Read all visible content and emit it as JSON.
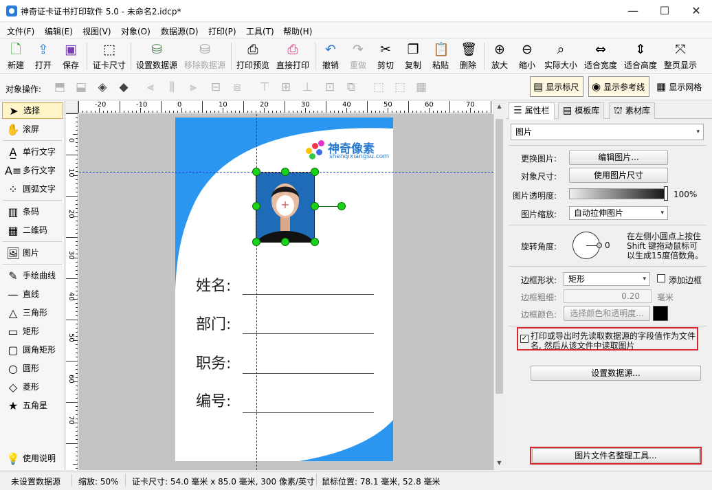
{
  "window": {
    "title": "神奇证卡证书打印软件 5.0 - 未命名2.idcp*"
  },
  "menu": [
    "文件(F)",
    "编辑(E)",
    "视图(V)",
    "对象(O)",
    "数据源(D)",
    "打印(P)",
    "工具(T)",
    "帮助(H)"
  ],
  "toolbar": [
    {
      "label": "新建",
      "icon": "new-file-icon"
    },
    {
      "label": "打开",
      "icon": "open-folder-icon"
    },
    {
      "label": "保存",
      "icon": "save-icon"
    },
    {
      "label": "证卡尺寸",
      "icon": "card-size-icon"
    },
    {
      "label": "设置数据源",
      "icon": "database-icon"
    },
    {
      "label": "移除数据源",
      "icon": "remove-database-icon",
      "disabled": true
    },
    {
      "label": "打印预览",
      "icon": "print-preview-icon"
    },
    {
      "label": "直接打印",
      "icon": "printer-icon"
    },
    {
      "label": "撤销",
      "icon": "undo-icon"
    },
    {
      "label": "重做",
      "icon": "redo-icon",
      "disabled": true
    },
    {
      "label": "剪切",
      "icon": "scissors-icon"
    },
    {
      "label": "复制",
      "icon": "copy-icon"
    },
    {
      "label": "粘贴",
      "icon": "paste-icon"
    },
    {
      "label": "删除",
      "icon": "trash-icon"
    },
    {
      "label": "放大",
      "icon": "zoom-in-icon"
    },
    {
      "label": "缩小",
      "icon": "zoom-out-icon"
    },
    {
      "label": "实际大小",
      "icon": "actual-size-icon"
    },
    {
      "label": "适合宽度",
      "icon": "fit-width-icon"
    },
    {
      "label": "适合高度",
      "icon": "fit-height-icon"
    },
    {
      "label": "整页显示",
      "icon": "fit-page-icon"
    }
  ],
  "toolbar2": {
    "label": "对象操作:",
    "show_ruler": "显示标尺",
    "show_guides": "显示参考线",
    "show_grid": "显示网格"
  },
  "tools": [
    {
      "label": "选择",
      "icon": "arrow-cursor-icon"
    },
    {
      "label": "滚屏",
      "icon": "hand-icon"
    },
    {
      "label": "单行文字",
      "icon": "single-line-text-icon"
    },
    {
      "label": "多行文字",
      "icon": "multi-line-text-icon"
    },
    {
      "label": "圆弧文字",
      "icon": "arc-text-icon"
    },
    {
      "label": "条码",
      "icon": "barcode-icon"
    },
    {
      "label": "二维码",
      "icon": "qrcode-icon"
    },
    {
      "label": "图片",
      "icon": "image-icon"
    },
    {
      "label": "手绘曲线",
      "icon": "pen-icon"
    },
    {
      "label": "直线",
      "icon": "line-icon"
    },
    {
      "label": "三角形",
      "icon": "triangle-icon"
    },
    {
      "label": "矩形",
      "icon": "rectangle-icon"
    },
    {
      "label": "圆角矩形",
      "icon": "rounded-rect-icon"
    },
    {
      "label": "圆形",
      "icon": "circle-icon"
    },
    {
      "label": "菱形",
      "icon": "diamond-icon"
    },
    {
      "label": "五角星",
      "icon": "star-icon"
    }
  ],
  "help": {
    "label": "使用说明",
    "icon": "lightbulb-icon"
  },
  "ruler": {
    "top": [
      "-20",
      "-10",
      "0",
      "10",
      "20",
      "30",
      "40",
      "50",
      "60",
      "70"
    ],
    "left": [
      "0",
      "10",
      "20",
      "30",
      "40",
      "50",
      "60",
      "70"
    ]
  },
  "card": {
    "logo_text": "神奇像素",
    "logo_sub": "shenqixiangsu.com",
    "fields": [
      "姓名:",
      "部门:",
      "职务:",
      "编号:"
    ]
  },
  "panel": {
    "tabs": [
      "属性栏",
      "模板库",
      "素材库"
    ],
    "type": "图片",
    "change_image_label": "更换图片:",
    "edit_image_btn": "编辑图片...",
    "object_size_label": "对象尺寸:",
    "use_image_size_btn": "使用图片尺寸",
    "opacity_label": "图片透明度:",
    "opacity_value": "100%",
    "opacity": 1.0,
    "scale_label": "图片缩放:",
    "scale_value": "自动拉伸图片",
    "rotate_label": "旋转角度:",
    "rotate_value": "0",
    "rotate_hint_1": "在左侧小圆点上按住",
    "rotate_hint_2": "Shift 键拖动鼠标可",
    "rotate_hint_3": "以生成15度倍数角。",
    "border_shape_label": "边框形状:",
    "border_shape_value": "矩形",
    "add_border_label": "添加边框",
    "border_width_label": "边框粗细:",
    "border_width_value": "0.20",
    "border_unit": "毫米",
    "border_color_label": "边框颜色:",
    "border_color_btn": "选择颜色和透明度...",
    "border_color": "#000000",
    "datasource_check_1": "打印或导出时先读取数据源的字段值作为文件",
    "datasource_check_2": "名, 然后从该文件中读取图片",
    "set_datasource_btn": "设置数据源...",
    "rename_tool_btn": "图片文件名整理工具..."
  },
  "status": {
    "datasource": "未设置数据源",
    "zoom": "缩放: 50%",
    "card_size": "证卡尺寸: 54.0 毫米 x 85.0 毫米, 300 像素/英寸",
    "mouse": "鼠标位置: 78.1 毫米, 52.8 毫米"
  },
  "colors": {
    "accent": "#2b96f0",
    "guide": "#1a3fd8",
    "handle": "#19d219",
    "highlight": "#d9262c"
  }
}
